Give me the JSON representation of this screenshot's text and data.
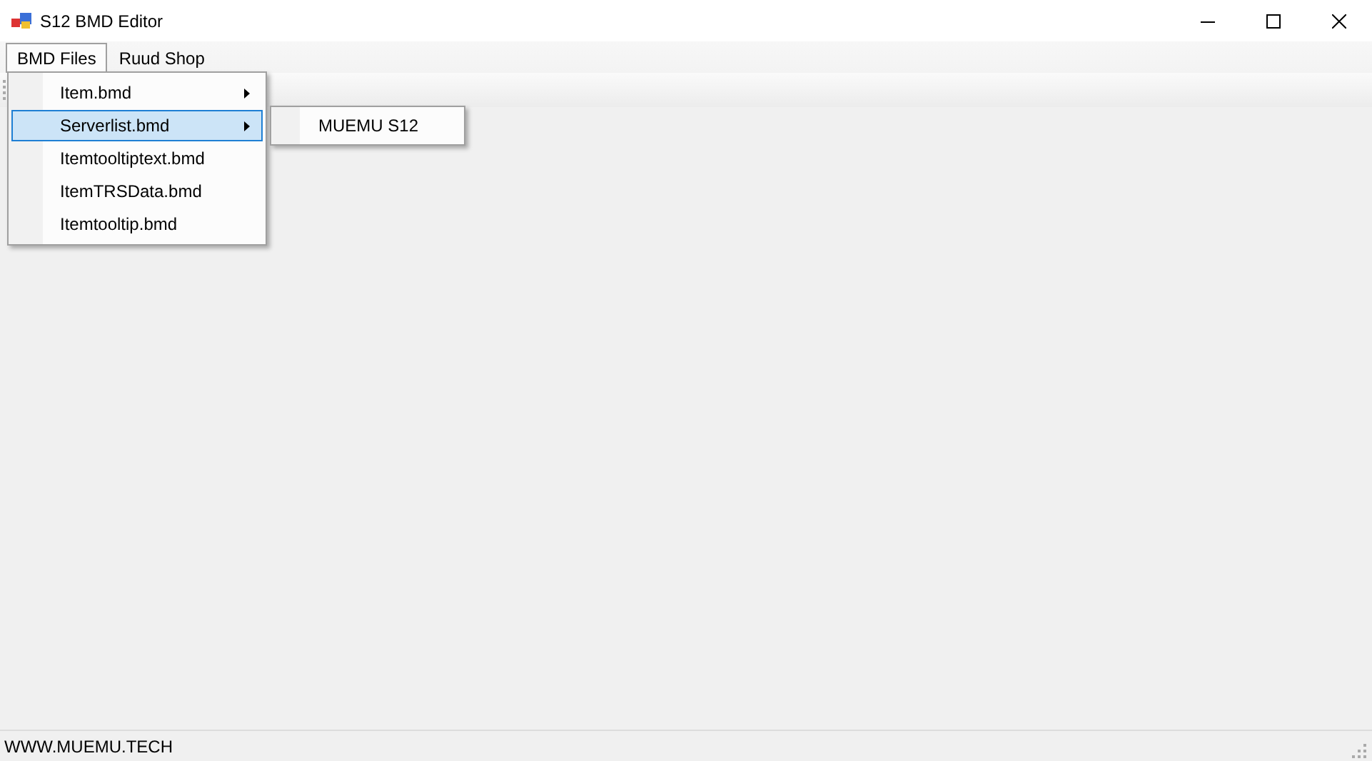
{
  "window": {
    "title": "S12 BMD Editor"
  },
  "menu_bar": [
    {
      "label": "BMD Files",
      "selected": true
    },
    {
      "label": "Ruud Shop",
      "selected": false
    }
  ],
  "dropdown": {
    "items": [
      {
        "label": "Item.bmd",
        "selected": false,
        "has_submenu": true
      },
      {
        "label": "Serverlist.bmd",
        "selected": true,
        "has_submenu": true
      },
      {
        "label": "Itemtooltiptext.bmd",
        "selected": false,
        "has_submenu": false
      },
      {
        "label": "ItemTRSData.bmd",
        "selected": false,
        "has_submenu": false
      },
      {
        "label": "Itemtooltip.bmd",
        "selected": false,
        "has_submenu": false
      }
    ]
  },
  "submenu": {
    "items": [
      {
        "label": "MUEMU S12",
        "selected": false
      }
    ]
  },
  "status_bar": {
    "text": "WWW.MUEMU.TECH"
  }
}
